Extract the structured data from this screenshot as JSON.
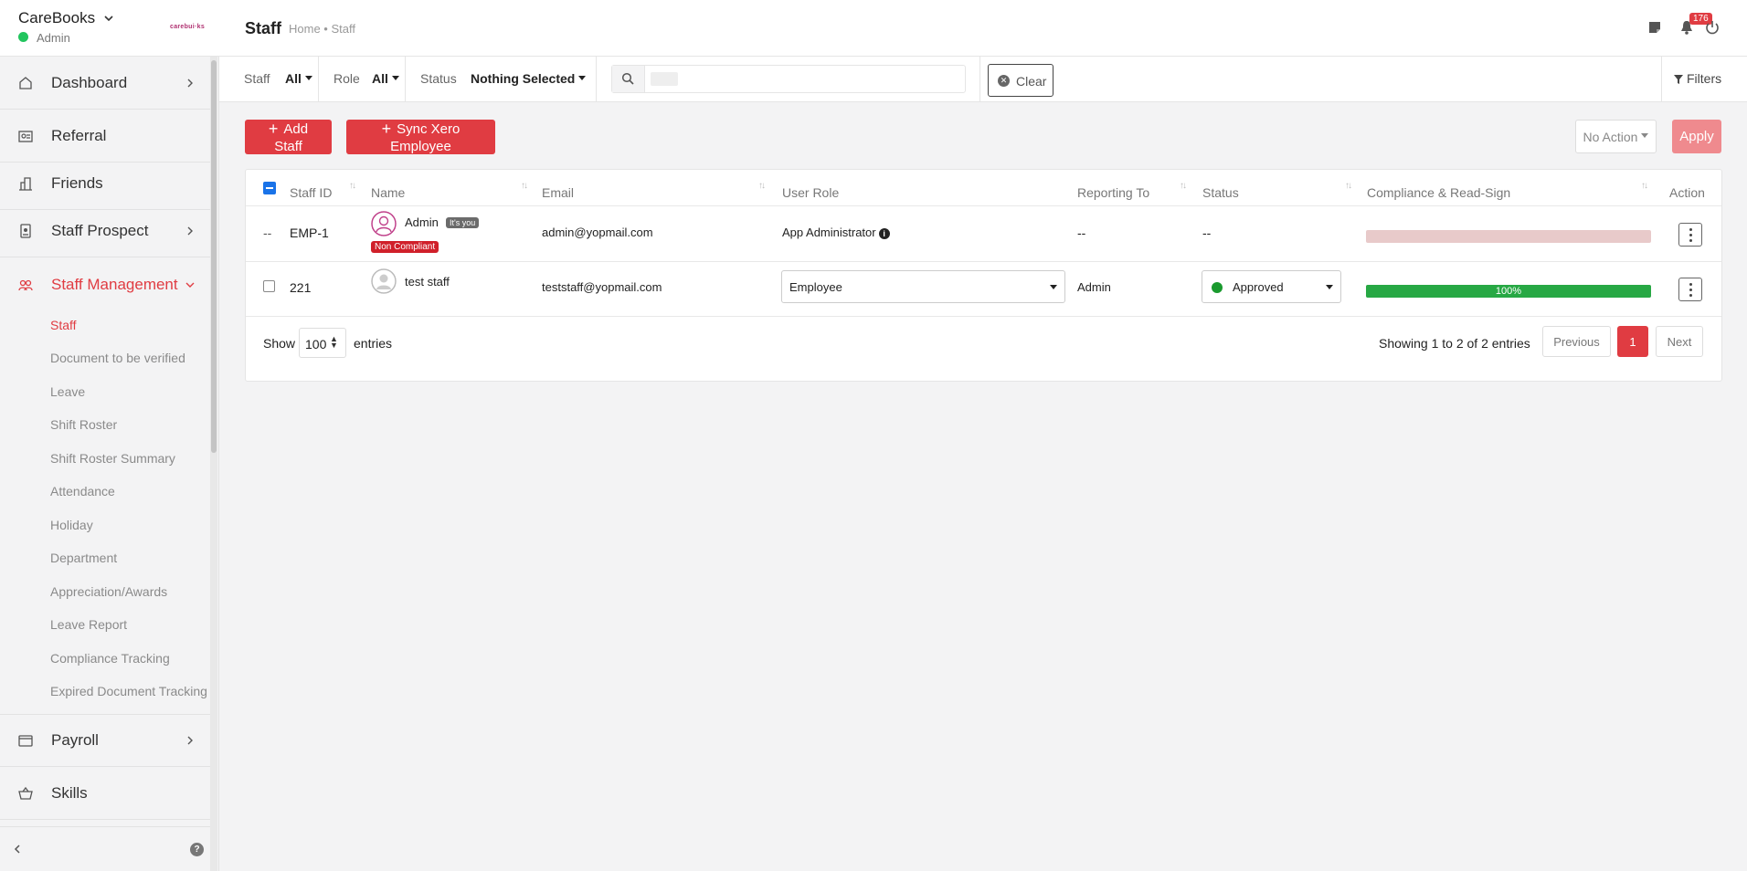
{
  "app": {
    "name": "CareBooks",
    "user_role": "Admin",
    "logo_text": "carebui·ks"
  },
  "sidebar": {
    "main_items": [
      {
        "label": "Dashboard",
        "icon": "home-icon",
        "has_arrow": true
      },
      {
        "label": "Referral",
        "icon": "id-card-icon",
        "has_arrow": false
      },
      {
        "label": "Friends",
        "icon": "building-icon",
        "has_arrow": false
      },
      {
        "label": "Staff Prospect",
        "icon": "badge-icon",
        "has_arrow": true
      },
      {
        "label": "Staff Management",
        "icon": "users-icon",
        "has_arrow": true,
        "active": true
      }
    ],
    "sub_items": [
      "Staff",
      "Document to be verified",
      "Leave",
      "Shift Roster",
      "Shift Roster Summary",
      "Attendance",
      "Holiday",
      "Department",
      "Appreciation/Awards",
      "Leave Report",
      "Compliance Tracking",
      "Expired Document Tracking"
    ],
    "bottom_items": [
      {
        "label": "Payroll",
        "icon": "wallet-icon",
        "has_arrow": true
      },
      {
        "label": "Skills",
        "icon": "basket-icon",
        "has_arrow": false
      }
    ],
    "help": "?"
  },
  "topbar": {
    "title": "Staff",
    "breadcrumb": "Home • Staff",
    "notification_count": "176"
  },
  "filters": {
    "staff_label": "Staff",
    "staff_value": "All",
    "role_label": "Role",
    "role_value": "All",
    "status_label": "Status",
    "status_value": "Nothing Selected",
    "search_placeholder": "",
    "clear_label": "Clear",
    "filters_label": "Filters"
  },
  "actions": {
    "add_staff": "Add Staff",
    "sync_xero": "Sync Xero Employee",
    "bulk_action": "No Action",
    "apply": "Apply"
  },
  "table": {
    "headers": [
      "Staff ID",
      "Name",
      "Email",
      "User Role",
      "Reporting To",
      "Status",
      "Compliance & Read-Sign",
      "Action"
    ],
    "rows": [
      {
        "check": "--",
        "staff_id": "EMP-1",
        "name": "Admin",
        "you_tag": "It's you",
        "compliance_tag": "Non Compliant",
        "email": "admin@yopmail.com",
        "role": "App Administrator",
        "reporting_to": "--",
        "status": "--",
        "progress": 0,
        "progress_label": ""
      },
      {
        "staff_id": "221",
        "name": "test staff",
        "email": "teststaff@yopmail.com",
        "role": "Employee",
        "reporting_to": "Admin",
        "status": "Approved",
        "progress": 100,
        "progress_label": "100%"
      }
    ]
  },
  "footer": {
    "show_label": "Show",
    "show_value": "100",
    "entries_label": "entries",
    "showing_text": "Showing 1 to 2 of 2 entries",
    "previous": "Previous",
    "current_page": "1",
    "next": "Next"
  },
  "colors": {
    "accent": "#e03c42",
    "success": "#27a844",
    "progress_empty": "#e8caca"
  }
}
